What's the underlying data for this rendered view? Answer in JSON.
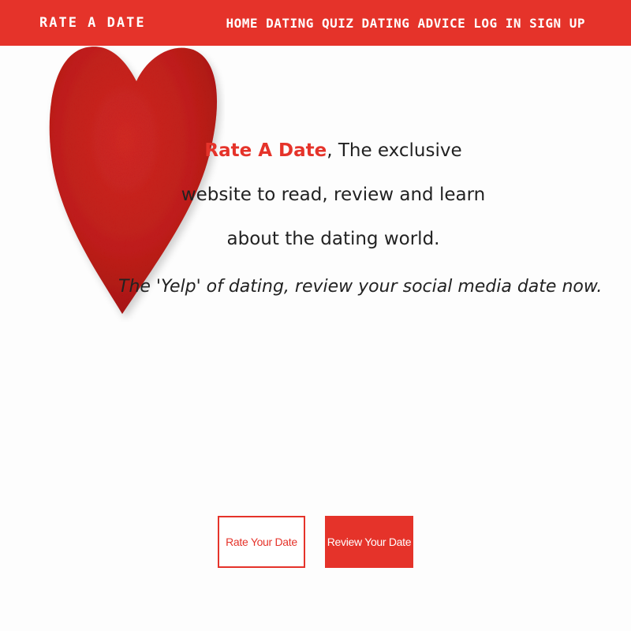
{
  "navbar": {
    "brand": "RATE A DATE",
    "links": [
      "HOME",
      "DATING QUIZ",
      "DATING ADVICE",
      "LOG IN",
      "SIGN UP"
    ]
  },
  "hero": {
    "brand_inline": "Rate A Date",
    "tagline_rest": ", The exclusive website to read, review and learn about the dating world.",
    "subtagline": "The 'Yelp' of dating, review your social media date now."
  },
  "buttons": {
    "rate": "Rate Your Date",
    "review": "Review Your Date"
  },
  "colors": {
    "accent": "#e5332a",
    "heart": "#c8201c",
    "text": "#222222",
    "background": "#ffffff"
  },
  "icons": {
    "hero_image": "red-felt-heart"
  }
}
